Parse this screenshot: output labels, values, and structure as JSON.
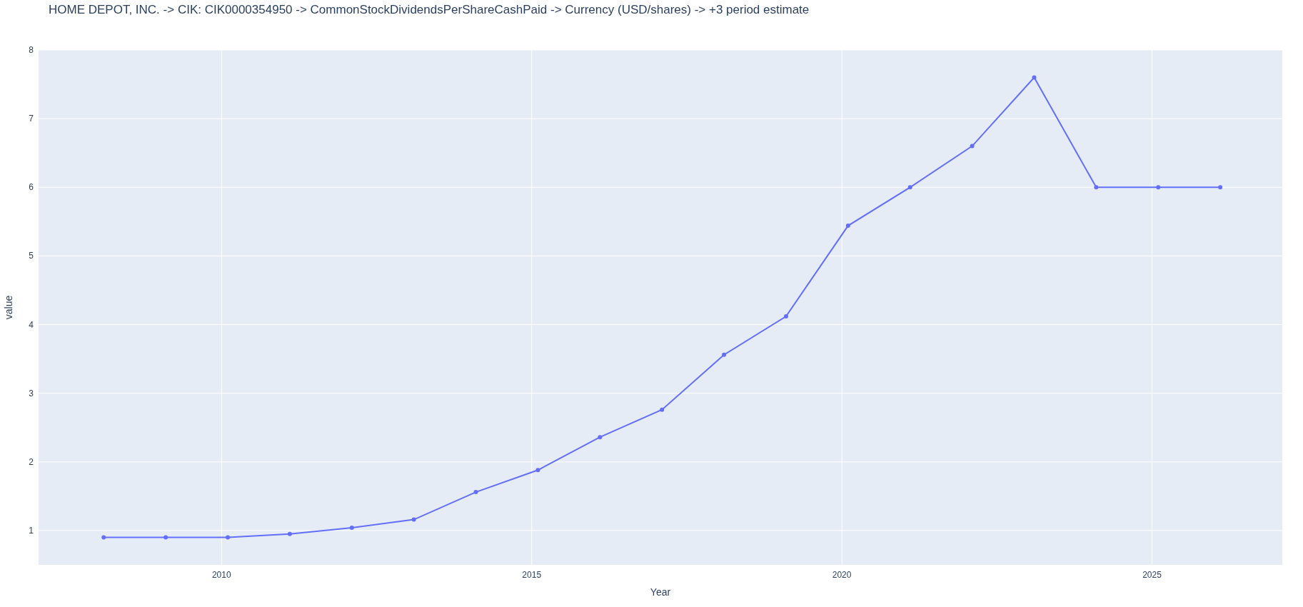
{
  "chart_data": {
    "type": "line",
    "title": "HOME DEPOT, INC. -> CIK: CIK0000354950 -> CommonStockDividendsPerShareCashPaid -> Currency (USD/shares) -> +3 period estimate",
    "xlabel": "Year",
    "ylabel": "value",
    "x": [
      2008.1,
      2009.1,
      2010.1,
      2011.1,
      2012.1,
      2013.1,
      2014.1,
      2015.1,
      2016.1,
      2017.1,
      2018.1,
      2019.1,
      2020.1,
      2021.1,
      2022.1,
      2023.1,
      2024.1,
      2025.1,
      2026.1
    ],
    "grid": true,
    "series": [
      {
        "color": "#636efa",
        "marker": true,
        "values": [
          0.9,
          0.9,
          0.9,
          0.95,
          1.04,
          1.16,
          1.56,
          1.88,
          2.36,
          2.76,
          3.56,
          4.12,
          5.44,
          6.0,
          6.6,
          7.6,
          6.0,
          6.0,
          6.0
        ]
      }
    ],
    "xlim": [
      2007.05,
      2027.1
    ],
    "ylim": [
      0.5,
      8
    ],
    "xticks": [
      2010,
      2015,
      2020,
      2025
    ],
    "yticks": [
      1,
      2,
      3,
      4,
      5,
      6,
      7,
      8
    ]
  }
}
